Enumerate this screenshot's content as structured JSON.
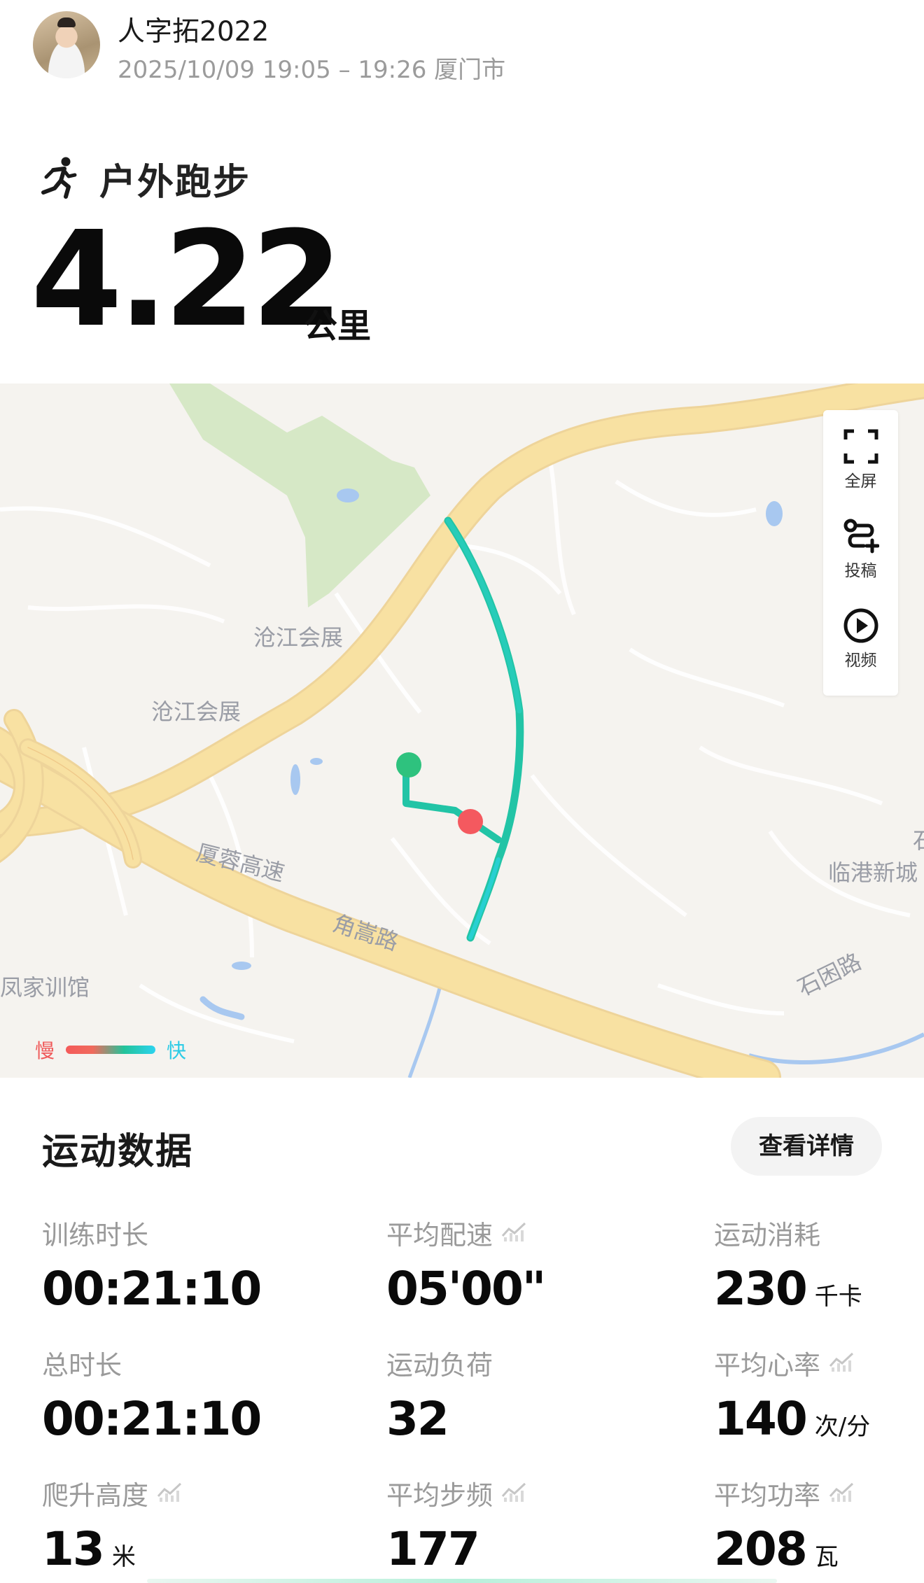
{
  "header": {
    "user_name": "人字拓2022",
    "meta": "2025/10/09 19:05 – 19:26 厦门市"
  },
  "activity": {
    "sport_name": "户外跑步",
    "sport_icon": "running-person-icon",
    "distance": "4.22",
    "distance_unit": "公里"
  },
  "map": {
    "labels": [
      "沧江会展",
      "沧江会展",
      "厦蓉高速",
      "角嵩路",
      "临港新城",
      "石困路",
      "凤家训馆",
      "石"
    ],
    "controls": [
      {
        "label": "全屏",
        "icon": "fullscreen-icon"
      },
      {
        "label": "投稿",
        "icon": "route-submit-icon"
      },
      {
        "label": "视频",
        "icon": "play-video-icon"
      }
    ],
    "legend": {
      "slow": "慢",
      "fast": "快"
    },
    "colors": {
      "start": "#2ec27e",
      "end": "#f4595f",
      "route": "#23c6a8",
      "road": "#f9e3a4",
      "park": "#d8e8c8",
      "water": "#a9c9f1"
    }
  },
  "stats": {
    "title": "运动数据",
    "detail_button": "查看详情",
    "items": [
      {
        "label": "训练时长",
        "value": "00:21:10",
        "unit": "",
        "chart": false
      },
      {
        "label": "平均配速",
        "value": "05'00\"",
        "unit": "",
        "chart": true
      },
      {
        "label": "运动消耗",
        "value": "230",
        "unit": "千卡",
        "chart": false
      },
      {
        "label": "总时长",
        "value": "00:21:10",
        "unit": "",
        "chart": false
      },
      {
        "label": "运动负荷",
        "value": "32",
        "unit": "",
        "chart": false
      },
      {
        "label": "平均心率",
        "value": "140",
        "unit": "次/分",
        "chart": true
      },
      {
        "label": "爬升高度",
        "value": "13",
        "unit": "米",
        "chart": true
      },
      {
        "label": "平均步频",
        "value": "177",
        "unit": "",
        "chart": true
      },
      {
        "label": "平均功率",
        "value": "208",
        "unit": "瓦",
        "chart": true
      }
    ]
  }
}
